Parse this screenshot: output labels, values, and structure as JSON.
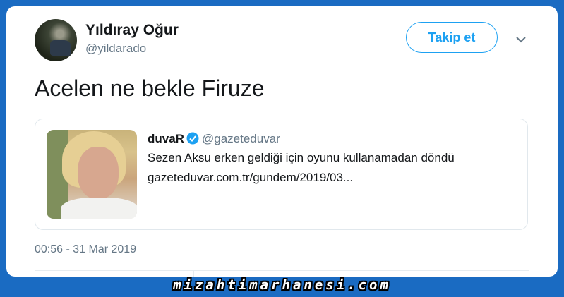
{
  "author": {
    "display_name": "Yıldıray Oğur",
    "handle": "@yildarado"
  },
  "follow_button": {
    "label": "Takip et"
  },
  "tweet": {
    "text": "Acelen ne bekle Firuze",
    "timestamp": "00:56 - 31 Mar 2019"
  },
  "quoted": {
    "name": "duvaR",
    "handle": "@gazeteduvar",
    "line1": "Sezen Aksu erken geldiği için oyunu kullanamadan döndü",
    "line2": "gazeteduvar.com.tr/gundem/2019/03..."
  },
  "watermark": "mizahtimarhanesi.com",
  "colors": {
    "frame": "#1a6bc2",
    "accent": "#1da1f2",
    "muted": "#657786",
    "text": "#14171a"
  },
  "icons": {
    "menu": "chevron-down-icon",
    "verified": "verified-badge-icon"
  }
}
